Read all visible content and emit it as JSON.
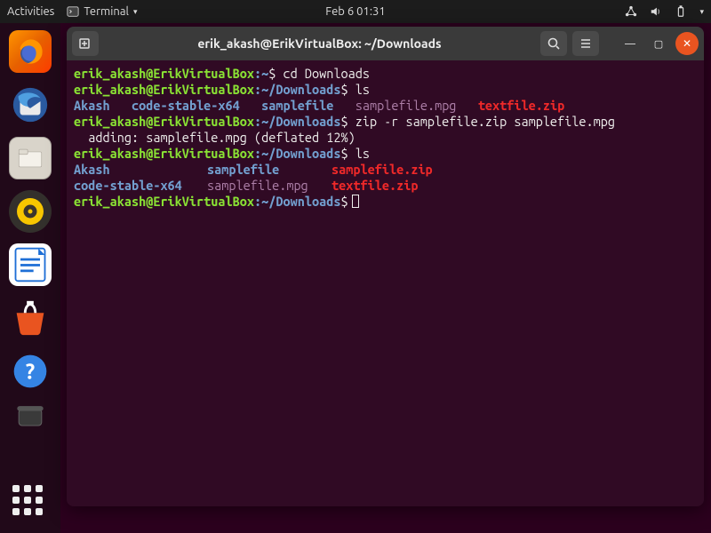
{
  "topbar": {
    "activities": "Activities",
    "terminal_label": "Terminal",
    "datetime": "Feb 6  01:31"
  },
  "dock": {
    "items": [
      "firefox",
      "thunderbird",
      "files",
      "rhythmbox",
      "writer",
      "software",
      "help",
      "trash"
    ]
  },
  "window": {
    "title": "erik_akash@ErikVirtualBox: ~/Downloads"
  },
  "term": {
    "prompt_user": "erik_akash@ErikVirtualBox",
    "prompt_sep": ":",
    "prompt_dollar": "$",
    "home_path": "~",
    "dl_path": "~/Downloads",
    "lines": {
      "l1_cmd": " cd Downloads",
      "l2_cmd": " ls",
      "l3_akash": "Akash",
      "l3_code": "code-stable-x64",
      "l3_sample": "samplefile",
      "l3_mpg": "samplefile.mpg",
      "l3_zip": "textfile.zip",
      "l4_cmd": " zip -r samplefile.zip samplefile.mpg",
      "l5_out": "  adding: samplefile.mpg (deflated 12%)",
      "l6_cmd": " ls",
      "l7a_akash": "Akash",
      "l7a_sample": "samplefile",
      "l7a_szip": "samplefile.zip",
      "l7b_code": "code-stable-x64",
      "l7b_mpg": "samplefile.mpg",
      "l7b_tzip": "textfile.zip"
    }
  }
}
